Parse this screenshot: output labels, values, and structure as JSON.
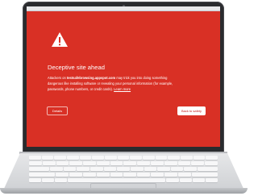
{
  "colors": {
    "interstitial_background": "#d93025",
    "text": "#ffffff",
    "primary_button_text": "#c5221f",
    "bezel": "#2a2b2e"
  },
  "warning_page": {
    "icon": "warning-triangle-icon",
    "title": "Deceptive site ahead",
    "message": {
      "line1_prefix": "Attackers on ",
      "site": "testsafebrowsing.appspot.com",
      "line1_suffix": " may trick you into doing something",
      "line2": "dangerous like installing software or revealing your personal information (for example,",
      "line3_prefix": "passwords, phone numbers, or credit cards). ",
      "learn_more": "Learn more"
    },
    "details_button": "Details",
    "back_button": "Back to safety"
  }
}
